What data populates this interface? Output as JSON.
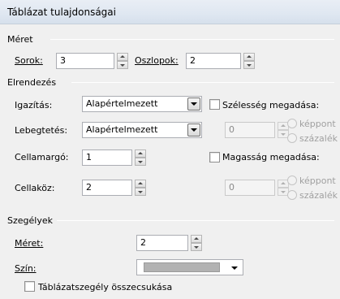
{
  "window": {
    "title": "Táblázat tulajdonságai"
  },
  "size": {
    "group_label": "Méret",
    "rows_label": "Sorok:",
    "rows_value": "3",
    "columns_label": "Oszlopok:",
    "columns_value": "2"
  },
  "layout": {
    "group_label": "Elrendezés",
    "alignment_label": "Igazítás:",
    "alignment_value": "Alapértelmezett",
    "float_label": "Lebegtetés:",
    "float_value": "Alapértelmezett",
    "cell_padding_label": "Cellamargó:",
    "cell_padding_value": "1",
    "cell_spacing_label": "Cellaköz:",
    "cell_spacing_value": "2",
    "width": {
      "checkbox_label": "Szélesség megadása:",
      "value": "0",
      "unit_pixels": "képpont",
      "unit_percent": "százalék"
    },
    "height": {
      "checkbox_label": "Magasság megadása:",
      "value": "0",
      "unit_pixels": "képpont",
      "unit_percent": "százalék"
    }
  },
  "borders": {
    "group_label": "Szegélyek",
    "size_label": "Méret:",
    "size_value": "2",
    "color_label": "Szín:",
    "color_swatch": "#b2b2b2",
    "collapse_label": "Táblázatszegély összecsukása"
  }
}
